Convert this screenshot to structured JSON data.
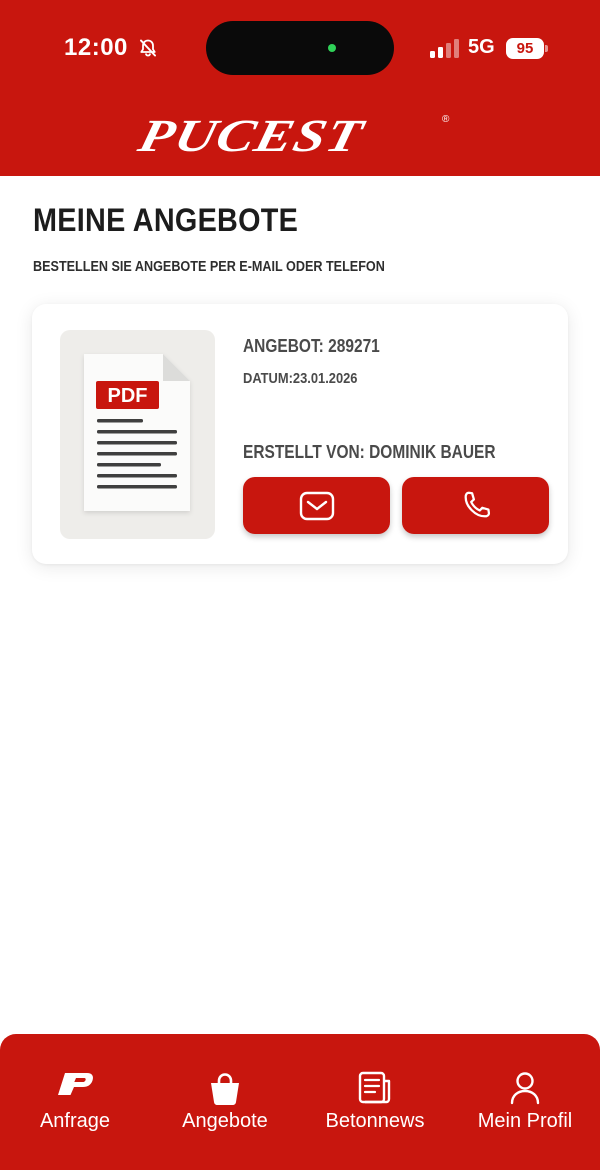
{
  "status_bar": {
    "time": "12:00",
    "network": "5G",
    "battery": "95",
    "icons": [
      "bell-slash-icon",
      "signal-icon"
    ]
  },
  "header": {
    "logo_text": "PUCEST",
    "logo_mark": "®",
    "background_color": "#c8160e"
  },
  "main": {
    "title": "MEINE ANGEBOTE",
    "subtitle": "BESTELLEN SIE ANGEBOTE PER E-MAIL ODER TELEFON"
  },
  "offers": [
    {
      "number_text": "ANGEBOT: 289271",
      "date_text": "DATUM:23.01.2026",
      "creator_text": "ERSTELLT VON: DOMINIK BAUER",
      "thumbnail_label": "PDF",
      "thumbnail_icon": "pdf-document-icon",
      "actions": [
        {
          "name": "email",
          "icon": "envelope-icon"
        },
        {
          "name": "phone",
          "icon": "phone-icon"
        }
      ]
    }
  ],
  "bottom_nav": {
    "items": [
      {
        "label": "Anfrage",
        "icon": "brand-p-icon"
      },
      {
        "label": "Angebote",
        "icon": "shopping-bag-icon"
      },
      {
        "label": "Betonnews",
        "icon": "newspaper-icon"
      },
      {
        "label": "Mein Profil",
        "icon": "user-icon"
      }
    ]
  },
  "colors": {
    "brand_red": "#c8160e",
    "text_dark": "#1c1c1c",
    "text_gray": "#4a4a4a",
    "status_green": "#2fd158"
  }
}
